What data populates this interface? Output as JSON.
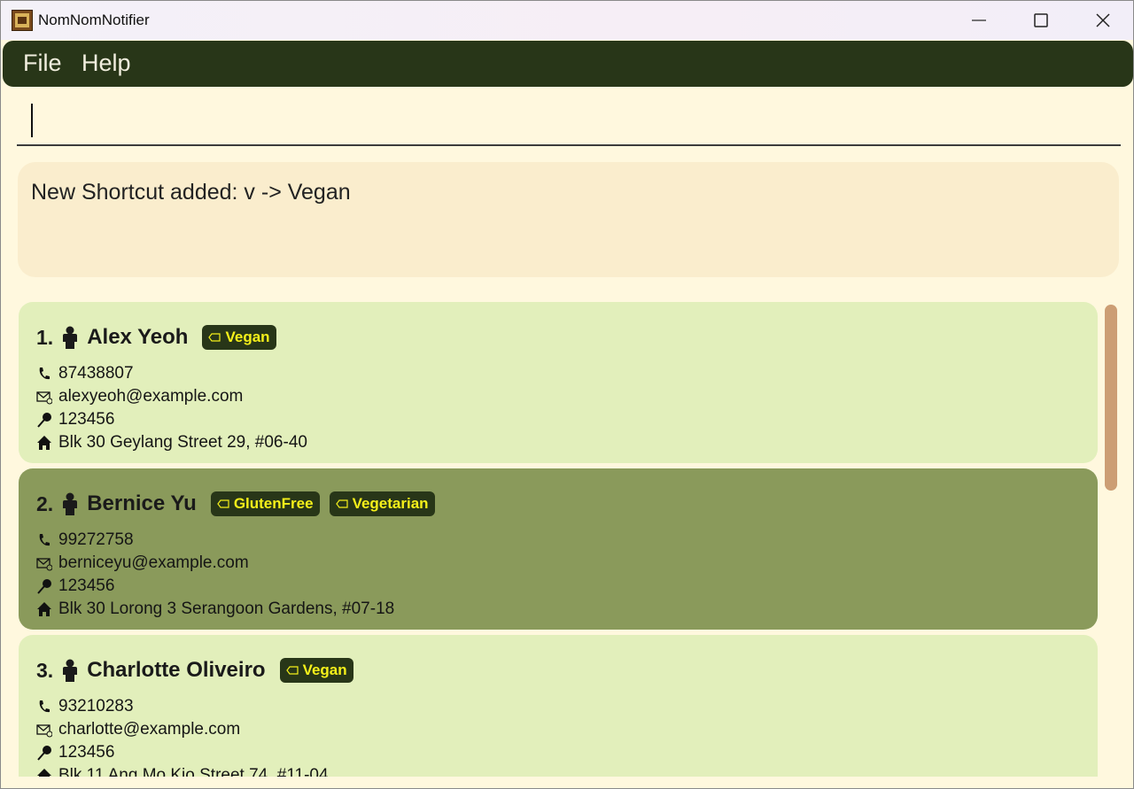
{
  "window": {
    "title": "NomNomNotifier"
  },
  "menu": {
    "file": "File",
    "help": "Help"
  },
  "command": {
    "value": ""
  },
  "result": {
    "message": "New Shortcut added: v -> Vegan"
  },
  "persons": [
    {
      "index": "1.",
      "name": "Alex Yeoh",
      "tags": [
        "Vegan"
      ],
      "phone": "87438807",
      "email": "alexyeoh@example.com",
      "postal": "123456",
      "address": "Blk 30 Geylang Street 29, #06-40"
    },
    {
      "index": "2.",
      "name": "Bernice Yu",
      "tags": [
        "GlutenFree",
        "Vegetarian"
      ],
      "phone": "99272758",
      "email": "berniceyu@example.com",
      "postal": "123456",
      "address": "Blk 30 Lorong 3 Serangoon Gardens, #07-18"
    },
    {
      "index": "3.",
      "name": "Charlotte Oliveiro",
      "tags": [
        "Vegan"
      ],
      "phone": "93210283",
      "email": "charlotte@example.com",
      "postal": "123456",
      "address": "Blk 11 Ang Mo Kio Street 74, #11-04"
    }
  ],
  "colors": {
    "menubar": "#283618",
    "card_light": "#e2efbb",
    "card_selected": "#8a9a5b",
    "tag_bg": "#283618",
    "tag_text": "#f5f01a",
    "result_bg": "#faedcd",
    "scrollbar": "#cc9e74"
  }
}
